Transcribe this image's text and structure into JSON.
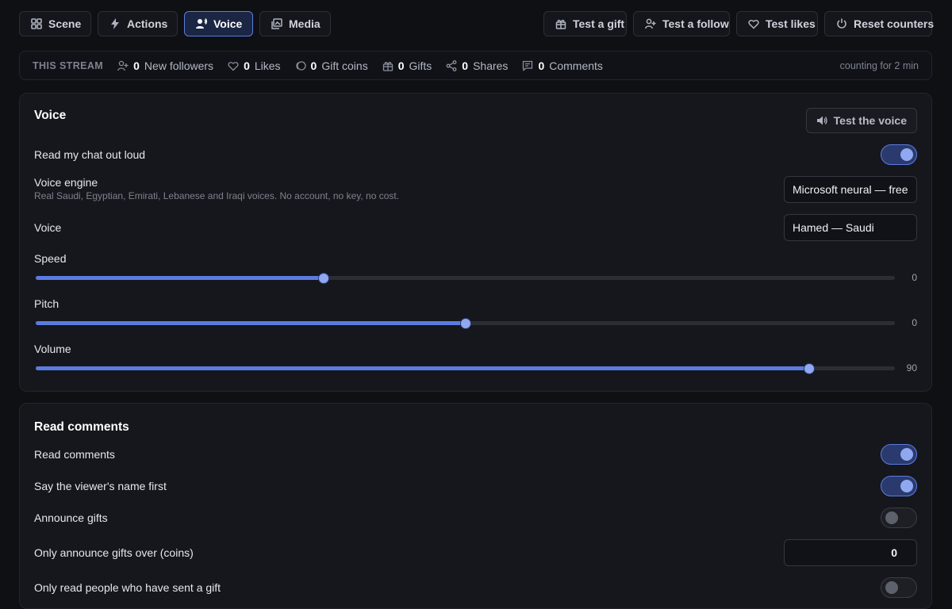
{
  "tabs": [
    {
      "label": "Scene",
      "icon": "grid-icon",
      "active": false
    },
    {
      "label": "Actions",
      "icon": "bolt-icon",
      "active": false
    },
    {
      "label": "Voice",
      "icon": "voice-icon",
      "active": true
    },
    {
      "label": "Media",
      "icon": "media-icon",
      "active": false
    }
  ],
  "actions": {
    "test_gift": "Test a gift",
    "test_follow": "Test a follow",
    "test_likes": "Test likes",
    "reset_counters": "Reset counters"
  },
  "stats": {
    "label": "THIS STREAM",
    "items": [
      {
        "value": "0",
        "label": "New followers",
        "icon": "user-plus-icon"
      },
      {
        "value": "0",
        "label": "Likes",
        "icon": "heart-icon"
      },
      {
        "value": "0",
        "label": "Gift coins",
        "icon": "coins-icon"
      },
      {
        "value": "0",
        "label": "Gifts",
        "icon": "gift-icon"
      },
      {
        "value": "0",
        "label": "Shares",
        "icon": "share-icon"
      },
      {
        "value": "0",
        "label": "Comments",
        "icon": "comment-icon"
      }
    ],
    "timer": "counting for 2 min"
  },
  "voice_card": {
    "title": "Voice",
    "test_button": "Test the voice",
    "read_chat": {
      "label": "Read my chat out loud",
      "on": true
    },
    "engine": {
      "label": "Voice engine",
      "description": "Real Saudi, Egyptian, Emirati, Lebanese and Iraqi voices. No account, no key, no cost.",
      "value": "Microsoft neural — free"
    },
    "voice": {
      "label": "Voice",
      "value": "Hamed — Saudi"
    },
    "sliders": [
      {
        "label": "Speed",
        "value": "0",
        "fraction": 0.335
      },
      {
        "label": "Pitch",
        "value": "0",
        "fraction": 0.5
      },
      {
        "label": "Volume",
        "value": "90",
        "fraction": 0.9
      }
    ]
  },
  "comments_card": {
    "title": "Read comments",
    "read_comments": {
      "label": "Read comments",
      "on": true
    },
    "say_name": {
      "label": "Say the viewer's name first",
      "on": true
    },
    "announce_gifts": {
      "label": "Announce gifts",
      "on": false
    },
    "gift_threshold": {
      "label": "Only announce gifts over (coins)",
      "value": "0"
    },
    "only_gifters": {
      "label": "Only read people who have sent a gift",
      "on": false
    }
  }
}
